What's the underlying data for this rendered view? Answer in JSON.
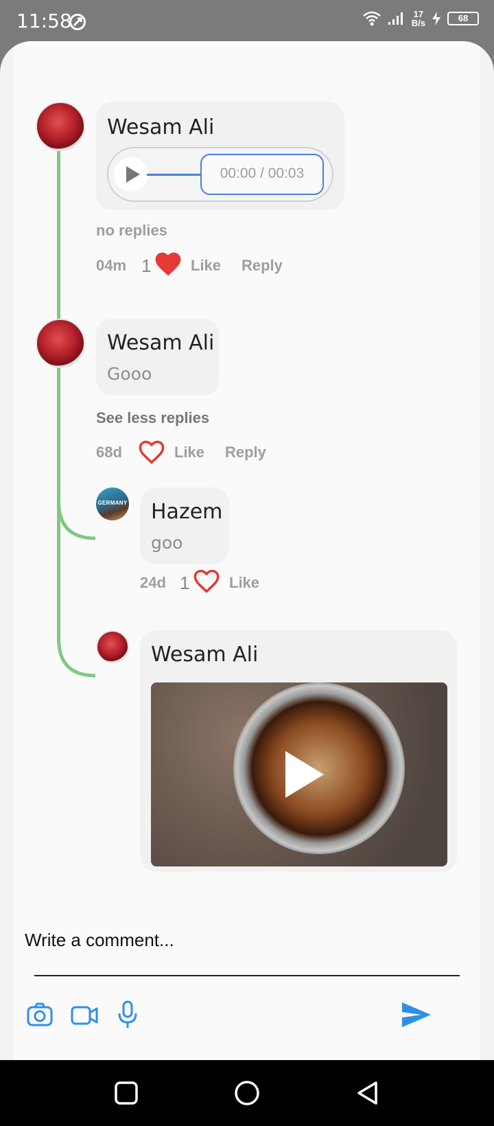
{
  "status_bar": {
    "time": "11:58",
    "net_speed_value": "17",
    "net_speed_unit": "B/s",
    "battery": "68"
  },
  "comments": [
    {
      "author": "Wesam Ali",
      "type": "audio",
      "audio_time": "00:00 / 00:03",
      "replies_toggle": "no replies",
      "age": "04m",
      "like_count": "1",
      "liked": true,
      "like_label": "Like",
      "reply_label": "Reply"
    },
    {
      "author": "Wesam Ali",
      "type": "text",
      "text": "Gooo",
      "replies_toggle": "See less replies",
      "age": "68d",
      "liked": false,
      "like_label": "Like",
      "reply_label": "Reply",
      "replies": [
        {
          "author": "Hazem",
          "avatar_text": "GERMANY",
          "text": "goo",
          "age": "24d",
          "like_count": "1",
          "liked": false,
          "like_label": "Like"
        },
        {
          "author": "Wesam Ali",
          "type": "video"
        }
      ]
    }
  ],
  "composer": {
    "placeholder": "Write a comment..."
  },
  "icons": {
    "camera": "camera-icon",
    "video": "video-camera-icon",
    "mic": "microphone-icon",
    "send": "send-icon"
  },
  "colors": {
    "accent": "#2f8fe6",
    "thread": "#81c784",
    "heart": "#e53935"
  }
}
